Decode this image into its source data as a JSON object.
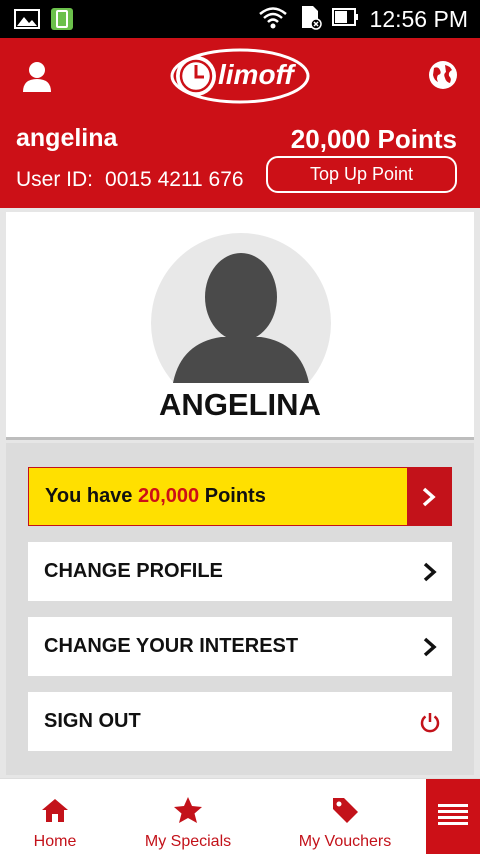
{
  "status_bar": {
    "time": "12:56 PM"
  },
  "header": {
    "logo_text": "limoff",
    "username": "angelina",
    "points": "20,000 Points",
    "user_id_label": "User ID:",
    "user_id_value": "0015 4211 676",
    "top_up_label": "Top Up Point"
  },
  "profile": {
    "name": "ANGELINA"
  },
  "menu": {
    "points_prefix": "You have ",
    "points_value": "20,000",
    "points_suffix": " Points",
    "change_profile": "CHANGE PROFILE",
    "change_interest": "CHANGE YOUR INTEREST",
    "sign_out": "SIGN OUT"
  },
  "bottom_nav": {
    "home": "Home",
    "specials": "My Specials",
    "vouchers": "My Vouchers"
  },
  "colors": {
    "brand_red": "#cc1017",
    "highlight_yellow": "#ffe000"
  },
  "icons": {
    "header_left": "user-icon",
    "header_right": "globe-icon",
    "row_arrow": "chevron-right-icon",
    "sign_out": "power-icon",
    "nav_home": "home-icon",
    "nav_specials": "star-icon",
    "nav_vouchers": "tag-icon",
    "nav_menu": "hamburger-menu-icon"
  }
}
